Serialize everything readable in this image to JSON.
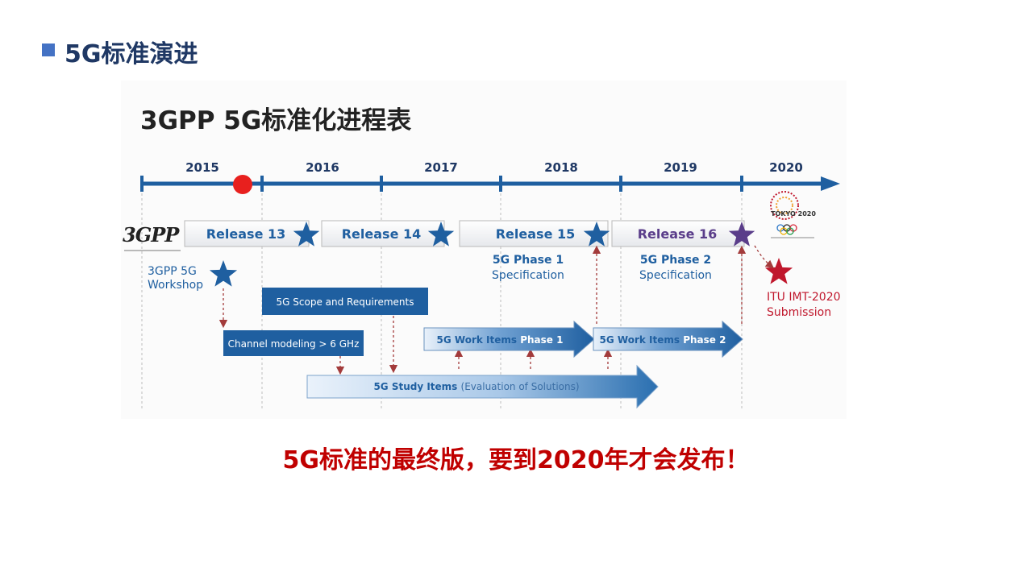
{
  "slide": {
    "title": "5G标准演进",
    "conclusion": "5G标准的最终版，要到2020年才会发布！"
  },
  "diagram": {
    "title": "3GPP 5G标准化进程表",
    "years": [
      "2015",
      "2016",
      "2017",
      "2018",
      "2019",
      "2020"
    ],
    "logo_3gpp": "3GPP",
    "tokyo_logo": "TOKYO 2020",
    "releases": [
      {
        "label": "Release 13",
        "star_color": "#1f5fa0"
      },
      {
        "label": "Release 14",
        "star_color": "#1f5fa0"
      },
      {
        "label": "Release 15",
        "star_color": "#1f5fa0"
      },
      {
        "label": "Release 16",
        "star_color": "#5a3d8a"
      }
    ],
    "workshop": {
      "line1": "3GPP 5G",
      "line2": "Workshop"
    },
    "phase1": {
      "title": "5G Phase 1",
      "sub": "Specification"
    },
    "phase2": {
      "title": "5G Phase 2",
      "sub": "Specification"
    },
    "itu": {
      "line1": "ITU IMT-2020",
      "line2": "Submission"
    },
    "bars": {
      "scope": "5G  Scope and Requirements",
      "channel": "Channel modeling > 6 GHz",
      "work1_main": "5G Work Items ",
      "work1_phase": "Phase 1",
      "work2_main": "5G Work Items ",
      "work2_phase": "Phase 2",
      "study_main": "5G Study Items ",
      "study_paren": "(Evaluation of Solutions)"
    },
    "colors": {
      "timeline": "#1f5fa0",
      "marker": "#e8201e",
      "itu_star": "#c0172c",
      "bar_dark": "#1f5fa0",
      "arrow_dashed": "#a33b3b"
    }
  }
}
